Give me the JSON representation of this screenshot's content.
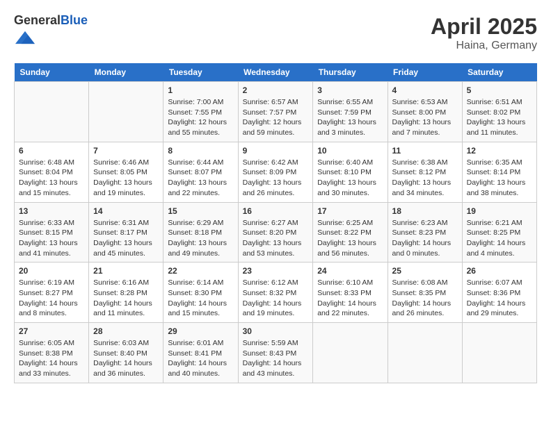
{
  "header": {
    "logo_general": "General",
    "logo_blue": "Blue",
    "title": "April 2025",
    "location": "Haina, Germany"
  },
  "weekdays": [
    "Sunday",
    "Monday",
    "Tuesday",
    "Wednesday",
    "Thursday",
    "Friday",
    "Saturday"
  ],
  "weeks": [
    [
      {
        "day": "",
        "sunrise": "",
        "sunset": "",
        "daylight": ""
      },
      {
        "day": "",
        "sunrise": "",
        "sunset": "",
        "daylight": ""
      },
      {
        "day": "1",
        "sunrise": "Sunrise: 7:00 AM",
        "sunset": "Sunset: 7:55 PM",
        "daylight": "Daylight: 12 hours and 55 minutes."
      },
      {
        "day": "2",
        "sunrise": "Sunrise: 6:57 AM",
        "sunset": "Sunset: 7:57 PM",
        "daylight": "Daylight: 12 hours and 59 minutes."
      },
      {
        "day": "3",
        "sunrise": "Sunrise: 6:55 AM",
        "sunset": "Sunset: 7:59 PM",
        "daylight": "Daylight: 13 hours and 3 minutes."
      },
      {
        "day": "4",
        "sunrise": "Sunrise: 6:53 AM",
        "sunset": "Sunset: 8:00 PM",
        "daylight": "Daylight: 13 hours and 7 minutes."
      },
      {
        "day": "5",
        "sunrise": "Sunrise: 6:51 AM",
        "sunset": "Sunset: 8:02 PM",
        "daylight": "Daylight: 13 hours and 11 minutes."
      }
    ],
    [
      {
        "day": "6",
        "sunrise": "Sunrise: 6:48 AM",
        "sunset": "Sunset: 8:04 PM",
        "daylight": "Daylight: 13 hours and 15 minutes."
      },
      {
        "day": "7",
        "sunrise": "Sunrise: 6:46 AM",
        "sunset": "Sunset: 8:05 PM",
        "daylight": "Daylight: 13 hours and 19 minutes."
      },
      {
        "day": "8",
        "sunrise": "Sunrise: 6:44 AM",
        "sunset": "Sunset: 8:07 PM",
        "daylight": "Daylight: 13 hours and 22 minutes."
      },
      {
        "day": "9",
        "sunrise": "Sunrise: 6:42 AM",
        "sunset": "Sunset: 8:09 PM",
        "daylight": "Daylight: 13 hours and 26 minutes."
      },
      {
        "day": "10",
        "sunrise": "Sunrise: 6:40 AM",
        "sunset": "Sunset: 8:10 PM",
        "daylight": "Daylight: 13 hours and 30 minutes."
      },
      {
        "day": "11",
        "sunrise": "Sunrise: 6:38 AM",
        "sunset": "Sunset: 8:12 PM",
        "daylight": "Daylight: 13 hours and 34 minutes."
      },
      {
        "day": "12",
        "sunrise": "Sunrise: 6:35 AM",
        "sunset": "Sunset: 8:14 PM",
        "daylight": "Daylight: 13 hours and 38 minutes."
      }
    ],
    [
      {
        "day": "13",
        "sunrise": "Sunrise: 6:33 AM",
        "sunset": "Sunset: 8:15 PM",
        "daylight": "Daylight: 13 hours and 41 minutes."
      },
      {
        "day": "14",
        "sunrise": "Sunrise: 6:31 AM",
        "sunset": "Sunset: 8:17 PM",
        "daylight": "Daylight: 13 hours and 45 minutes."
      },
      {
        "day": "15",
        "sunrise": "Sunrise: 6:29 AM",
        "sunset": "Sunset: 8:18 PM",
        "daylight": "Daylight: 13 hours and 49 minutes."
      },
      {
        "day": "16",
        "sunrise": "Sunrise: 6:27 AM",
        "sunset": "Sunset: 8:20 PM",
        "daylight": "Daylight: 13 hours and 53 minutes."
      },
      {
        "day": "17",
        "sunrise": "Sunrise: 6:25 AM",
        "sunset": "Sunset: 8:22 PM",
        "daylight": "Daylight: 13 hours and 56 minutes."
      },
      {
        "day": "18",
        "sunrise": "Sunrise: 6:23 AM",
        "sunset": "Sunset: 8:23 PM",
        "daylight": "Daylight: 14 hours and 0 minutes."
      },
      {
        "day": "19",
        "sunrise": "Sunrise: 6:21 AM",
        "sunset": "Sunset: 8:25 PM",
        "daylight": "Daylight: 14 hours and 4 minutes."
      }
    ],
    [
      {
        "day": "20",
        "sunrise": "Sunrise: 6:19 AM",
        "sunset": "Sunset: 8:27 PM",
        "daylight": "Daylight: 14 hours and 8 minutes."
      },
      {
        "day": "21",
        "sunrise": "Sunrise: 6:16 AM",
        "sunset": "Sunset: 8:28 PM",
        "daylight": "Daylight: 14 hours and 11 minutes."
      },
      {
        "day": "22",
        "sunrise": "Sunrise: 6:14 AM",
        "sunset": "Sunset: 8:30 PM",
        "daylight": "Daylight: 14 hours and 15 minutes."
      },
      {
        "day": "23",
        "sunrise": "Sunrise: 6:12 AM",
        "sunset": "Sunset: 8:32 PM",
        "daylight": "Daylight: 14 hours and 19 minutes."
      },
      {
        "day": "24",
        "sunrise": "Sunrise: 6:10 AM",
        "sunset": "Sunset: 8:33 PM",
        "daylight": "Daylight: 14 hours and 22 minutes."
      },
      {
        "day": "25",
        "sunrise": "Sunrise: 6:08 AM",
        "sunset": "Sunset: 8:35 PM",
        "daylight": "Daylight: 14 hours and 26 minutes."
      },
      {
        "day": "26",
        "sunrise": "Sunrise: 6:07 AM",
        "sunset": "Sunset: 8:36 PM",
        "daylight": "Daylight: 14 hours and 29 minutes."
      }
    ],
    [
      {
        "day": "27",
        "sunrise": "Sunrise: 6:05 AM",
        "sunset": "Sunset: 8:38 PM",
        "daylight": "Daylight: 14 hours and 33 minutes."
      },
      {
        "day": "28",
        "sunrise": "Sunrise: 6:03 AM",
        "sunset": "Sunset: 8:40 PM",
        "daylight": "Daylight: 14 hours and 36 minutes."
      },
      {
        "day": "29",
        "sunrise": "Sunrise: 6:01 AM",
        "sunset": "Sunset: 8:41 PM",
        "daylight": "Daylight: 14 hours and 40 minutes."
      },
      {
        "day": "30",
        "sunrise": "Sunrise: 5:59 AM",
        "sunset": "Sunset: 8:43 PM",
        "daylight": "Daylight: 14 hours and 43 minutes."
      },
      {
        "day": "",
        "sunrise": "",
        "sunset": "",
        "daylight": ""
      },
      {
        "day": "",
        "sunrise": "",
        "sunset": "",
        "daylight": ""
      },
      {
        "day": "",
        "sunrise": "",
        "sunset": "",
        "daylight": ""
      }
    ]
  ]
}
